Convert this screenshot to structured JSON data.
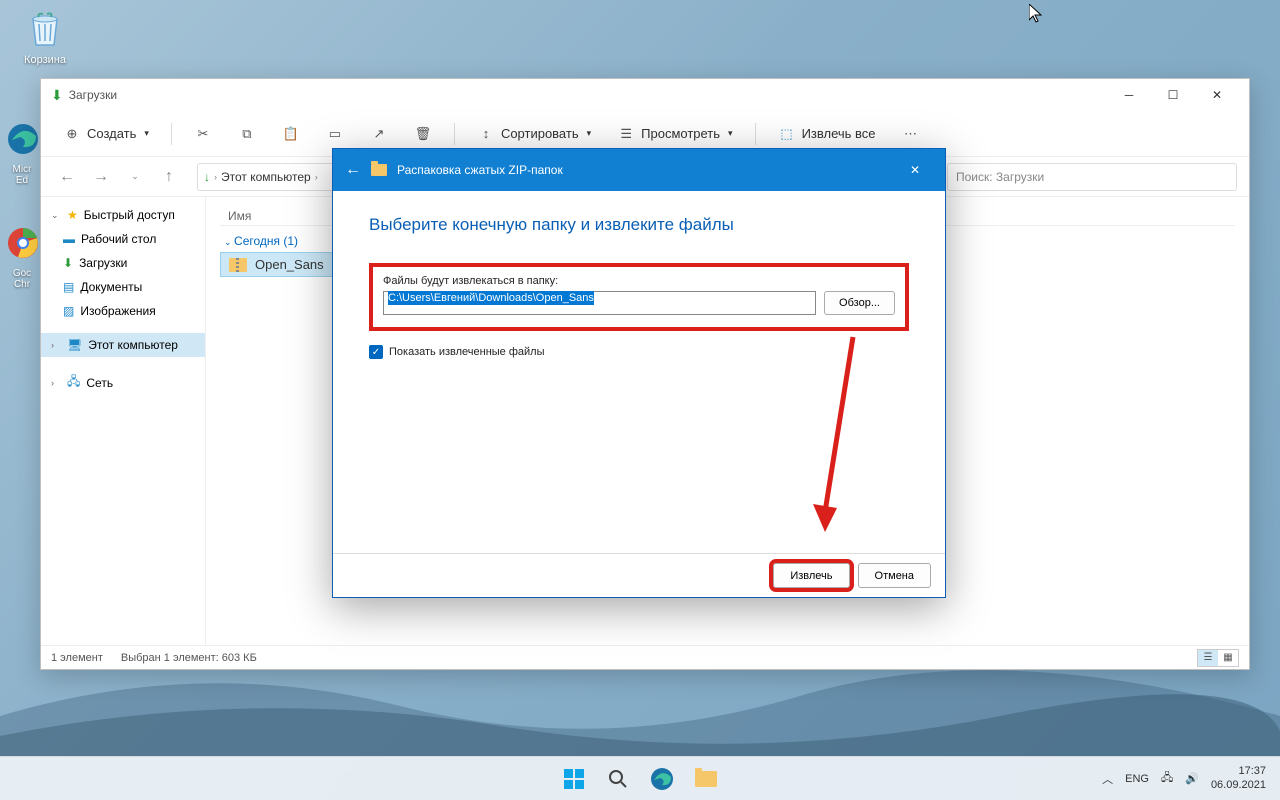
{
  "desktop": {
    "recycle_bin": "Корзина",
    "edge_partial": "Micr\nEd",
    "chrome_partial": "Goc\nChr"
  },
  "explorer": {
    "title": "Загрузки",
    "new_label": "Создать",
    "sort_label": "Сортировать",
    "view_label": "Просмотреть",
    "extract_label": "Извлечь все",
    "breadcrumb_download_icon": "↓",
    "breadcrumb": "Этот компьютер",
    "search_placeholder": "Поиск: Загрузки",
    "sidebar": {
      "quick": "Быстрый доступ",
      "desktop": "Рабочий стол",
      "downloads": "Загрузки",
      "documents": "Документы",
      "pictures": "Изображения",
      "this_pc": "Этот компьютер",
      "network": "Сеть"
    },
    "content": {
      "col_name": "Имя",
      "group_today": "Сегодня (1)",
      "file_name": "Open_Sans"
    },
    "status": {
      "count": "1 элемент",
      "selected": "Выбран 1 элемент: 603 КБ"
    }
  },
  "dialog": {
    "header": "Распаковка сжатых ZIP-папок",
    "title": "Выберите конечную папку и извлеките файлы",
    "field_label": "Файлы будут извлекаться в папку:",
    "path": "C:\\Users\\Евгений\\Downloads\\Open_Sans",
    "browse": "Обзор...",
    "checkbox": "Показать извлеченные файлы",
    "extract": "Извлечь",
    "cancel": "Отмена"
  },
  "taskbar": {
    "lang": "ENG",
    "time": "17:37",
    "date": "06.09.2021"
  }
}
